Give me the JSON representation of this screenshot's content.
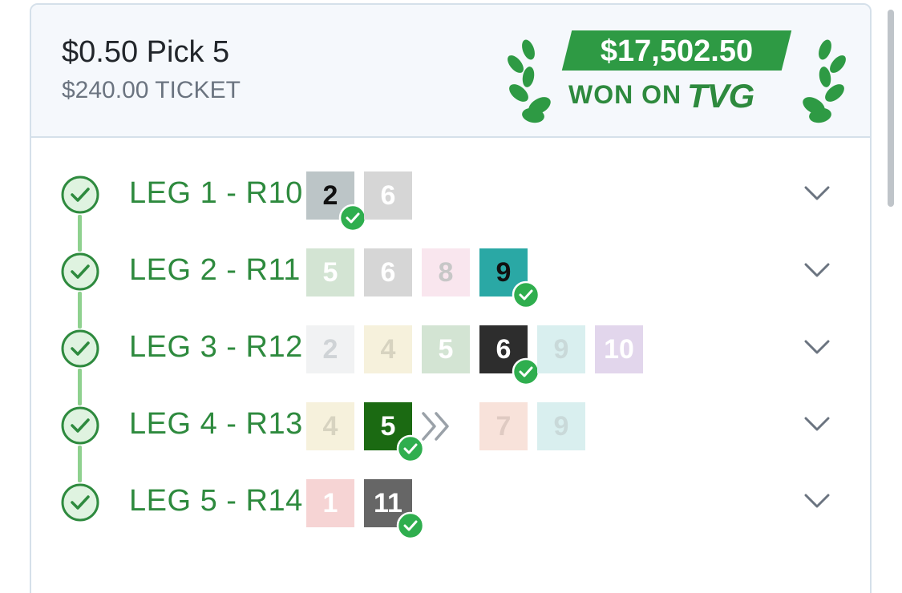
{
  "ticket": {
    "title": "$0.50 Pick 5",
    "subtitle": "$240.00 TICKET"
  },
  "win": {
    "amount": "$17,502.50",
    "won_on": "WON ON",
    "brand": "TVG"
  },
  "colors": {
    "accent_green": "#2e9a44",
    "label_green": "#2e8a3e",
    "connector_green": "#8fd18f"
  },
  "legs": [
    {
      "label": "LEG 1 - R10",
      "runners": [
        {
          "num": "2",
          "bg": "#bcc5c7",
          "fg": "#111111",
          "winner": true
        },
        {
          "num": "6",
          "bg": "#d6d6d6",
          "fg": "#ffffff",
          "winner": false
        }
      ]
    },
    {
      "label": "LEG 2 - R11",
      "runners": [
        {
          "num": "5",
          "bg": "#d3e4d3",
          "fg": "#ffffff",
          "winner": false
        },
        {
          "num": "6",
          "bg": "#d6d6d6",
          "fg": "#ffffff",
          "winner": false
        },
        {
          "num": "8",
          "bg": "#f9e6ee",
          "fg": "#c7c7c7",
          "winner": false
        },
        {
          "num": "9",
          "bg": "#2aa8a5",
          "fg": "#111111",
          "winner": true
        }
      ]
    },
    {
      "label": "LEG 3 - R12",
      "runners": [
        {
          "num": "2",
          "bg": "#f1f2f3",
          "fg": "#cfd3d6",
          "winner": false
        },
        {
          "num": "4",
          "bg": "#f6f1dc",
          "fg": "#d7d3c0",
          "winner": false
        },
        {
          "num": "5",
          "bg": "#d3e4d3",
          "fg": "#ffffff",
          "winner": false
        },
        {
          "num": "6",
          "bg": "#2d2d2d",
          "fg": "#ffffff",
          "winner": true
        },
        {
          "num": "9",
          "bg": "#d9efef",
          "fg": "#c9d9d9",
          "winner": false
        },
        {
          "num": "10",
          "bg": "#e2d6ec",
          "fg": "#ffffff",
          "winner": false
        }
      ]
    },
    {
      "label": "LEG 4 - R13",
      "runners": [
        {
          "num": "4",
          "bg": "#f6f1dc",
          "fg": "#d7d3c0",
          "winner": false
        },
        {
          "num": "5",
          "bg": "#1b6a12",
          "fg": "#ffffff",
          "winner": true
        },
        {
          "num": "7",
          "bg": "#f8e2da",
          "fg": "#dfcac2",
          "winner": false
        },
        {
          "num": "9",
          "bg": "#d9efef",
          "fg": "#c9d9d9",
          "winner": false
        }
      ],
      "scratch_arrow": true
    },
    {
      "label": "LEG 5 - R14",
      "runners": [
        {
          "num": "1",
          "bg": "#f6d4d4",
          "fg": "#ffffff",
          "winner": false
        },
        {
          "num": "11",
          "bg": "#666666",
          "fg": "#ffffff",
          "winner": true
        }
      ]
    }
  ]
}
